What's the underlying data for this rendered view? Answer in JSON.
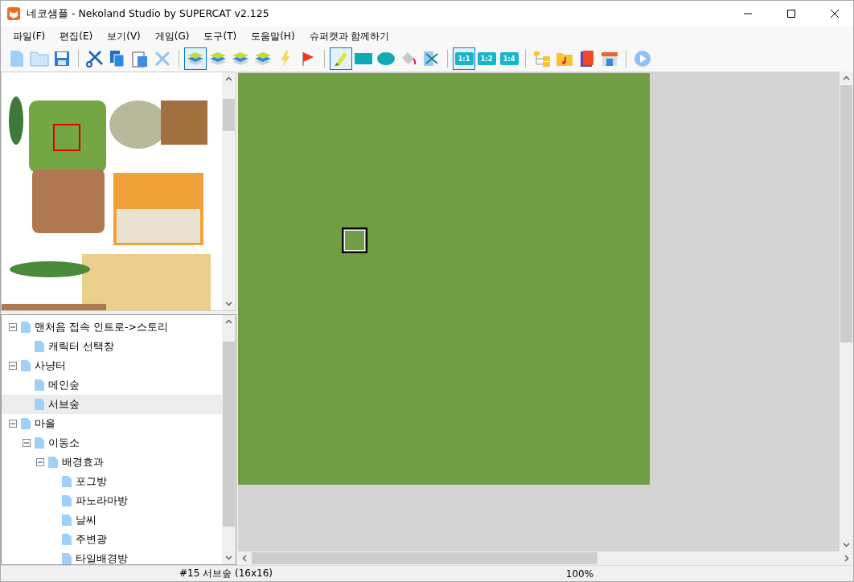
{
  "window": {
    "title": "네코샘플 - Nekoland Studio by SUPERCAT v2.125"
  },
  "menu": [
    "파일(F)",
    "편집(E)",
    "보기(V)",
    "게임(G)",
    "도구(T)",
    "도움말(H)",
    "슈퍼캣과 함께하기"
  ],
  "toolbar": [
    [
      {
        "kind": "new",
        "selected": false
      },
      {
        "kind": "open",
        "selected": false
      },
      {
        "kind": "save",
        "selected": false
      }
    ],
    [
      {
        "kind": "cut",
        "selected": false
      },
      {
        "kind": "copy",
        "selected": false
      },
      {
        "kind": "paste",
        "selected": false
      },
      {
        "kind": "delete",
        "selected": false
      }
    ],
    [
      {
        "kind": "layer",
        "selected": true
      },
      {
        "kind": "layer",
        "selected": false
      },
      {
        "kind": "layer",
        "selected": false
      },
      {
        "kind": "layer",
        "selected": false
      },
      {
        "kind": "event",
        "selected": false
      },
      {
        "kind": "flag",
        "selected": false
      }
    ],
    [
      {
        "kind": "pencil",
        "selected": true
      },
      {
        "kind": "rect",
        "selected": false
      },
      {
        "kind": "ellipse",
        "selected": false
      },
      {
        "kind": "fill",
        "selected": false
      },
      {
        "kind": "select",
        "selected": false
      }
    ],
    [
      {
        "kind": "zoom",
        "label": "1:1",
        "selected": true
      },
      {
        "kind": "zoom",
        "label": "1:2",
        "selected": false
      },
      {
        "kind": "zoom",
        "label": "1:4",
        "selected": false
      }
    ],
    [
      {
        "kind": "tree",
        "selected": false
      },
      {
        "kind": "music",
        "selected": false
      },
      {
        "kind": "book",
        "selected": false
      },
      {
        "kind": "shop",
        "selected": false
      }
    ],
    [
      {
        "kind": "play",
        "selected": false
      }
    ]
  ],
  "tree": [
    {
      "label": "맨처음 접속 인트로->스토리",
      "expanded": true,
      "selected": false,
      "children": [
        {
          "label": "캐릭터 선택창",
          "selected": false
        }
      ]
    },
    {
      "label": "사냥터",
      "expanded": true,
      "selected": false,
      "children": [
        {
          "label": "메인숲",
          "selected": false
        },
        {
          "label": "서브숲",
          "selected": true
        }
      ]
    },
    {
      "label": "마을",
      "expanded": true,
      "selected": false,
      "children": [
        {
          "label": "이동소",
          "expanded": true,
          "selected": false,
          "children": [
            {
              "label": "배경효과",
              "expanded": true,
              "selected": false,
              "children": [
                {
                  "label": "포그방",
                  "selected": false
                },
                {
                  "label": "파노라마방",
                  "selected": false
                },
                {
                  "label": "날씨",
                  "selected": false
                },
                {
                  "label": "주변광",
                  "selected": false
                },
                {
                  "label": "타일배경방",
                  "selected": false
                }
              ]
            }
          ]
        }
      ]
    }
  ],
  "status_bar": {
    "map": "#15 서브숲 (16x16)",
    "zoom": "100%"
  }
}
